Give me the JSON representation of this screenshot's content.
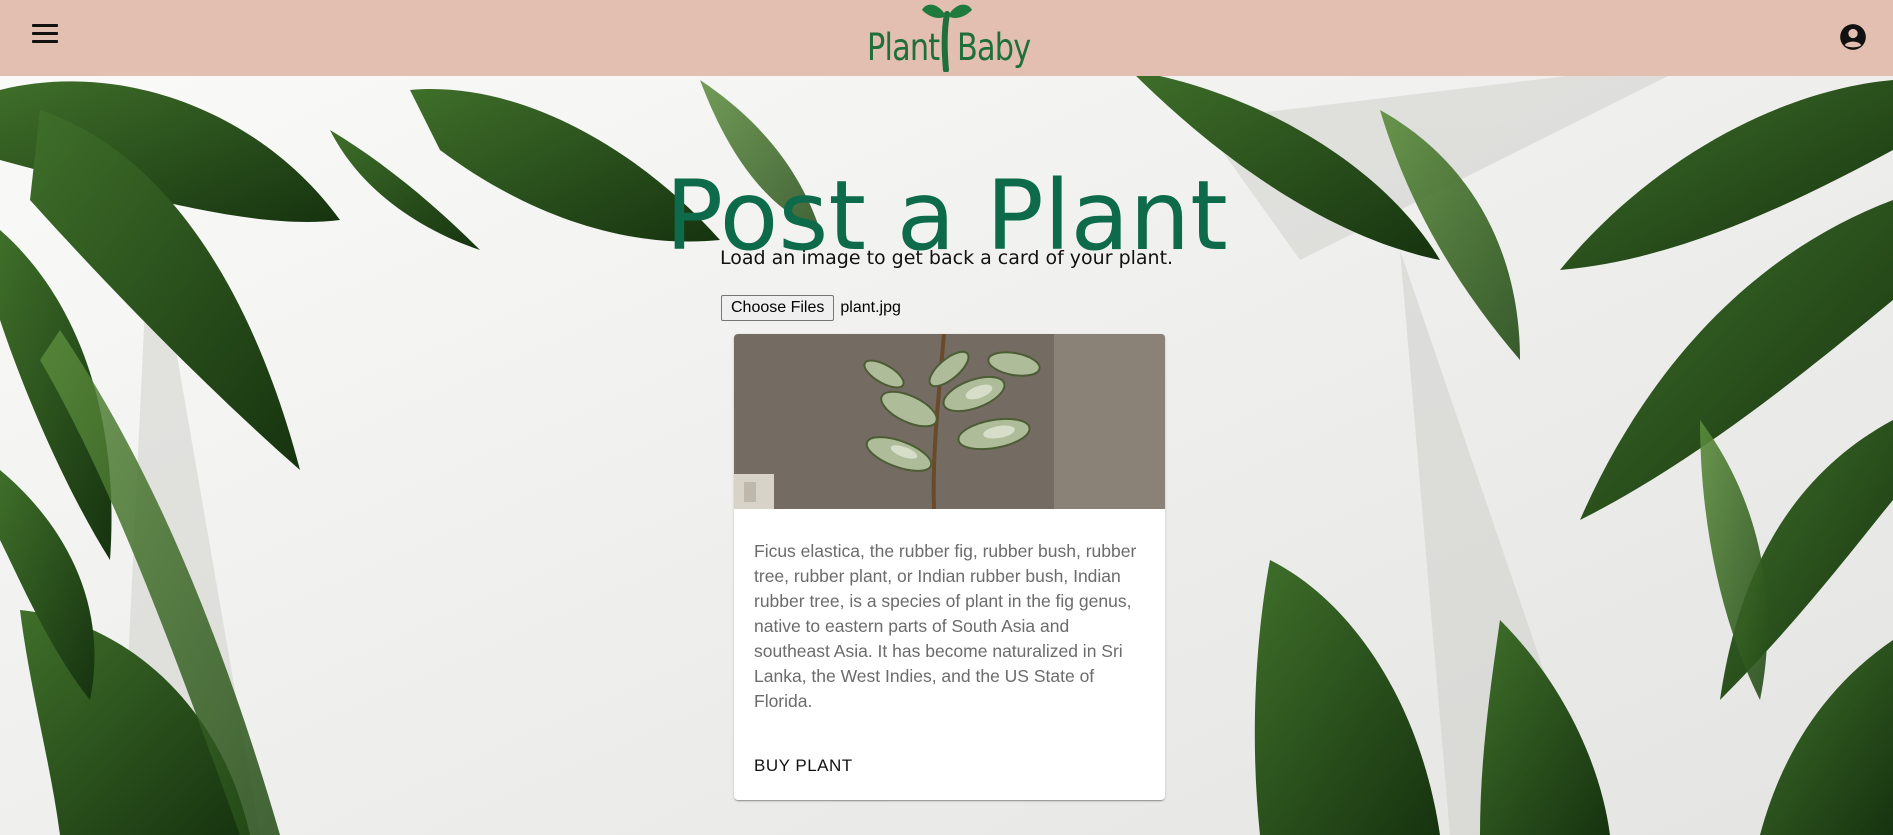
{
  "header": {
    "menu_icon": "hamburger-menu-icon",
    "logo": {
      "word_left": "Plant",
      "word_right": "Baby",
      "icon": "sprout-icon"
    },
    "account_icon": "account-circle-icon",
    "bar_color": "#e2bfb0"
  },
  "main": {
    "title": "Post a Plant",
    "subtitle": "Load an image to get back a card of your plant.",
    "file_input": {
      "button_label": "Choose Files",
      "file_name": "plant.jpg"
    }
  },
  "card": {
    "image_description": "plant-photo",
    "description": "Ficus elastica, the rubber fig, rubber bush, rubber tree, rubber plant, or Indian rubber bush, Indian rubber tree, is a species of plant in the fig genus, native to eastern parts of South Asia and southeast Asia. It has become naturalized in Sri Lanka, the West Indies, and the US State of Florida.",
    "action_label": "BUY PLANT"
  },
  "colors": {
    "title": "#0d6a4a",
    "logo": "#1f6f3d"
  }
}
